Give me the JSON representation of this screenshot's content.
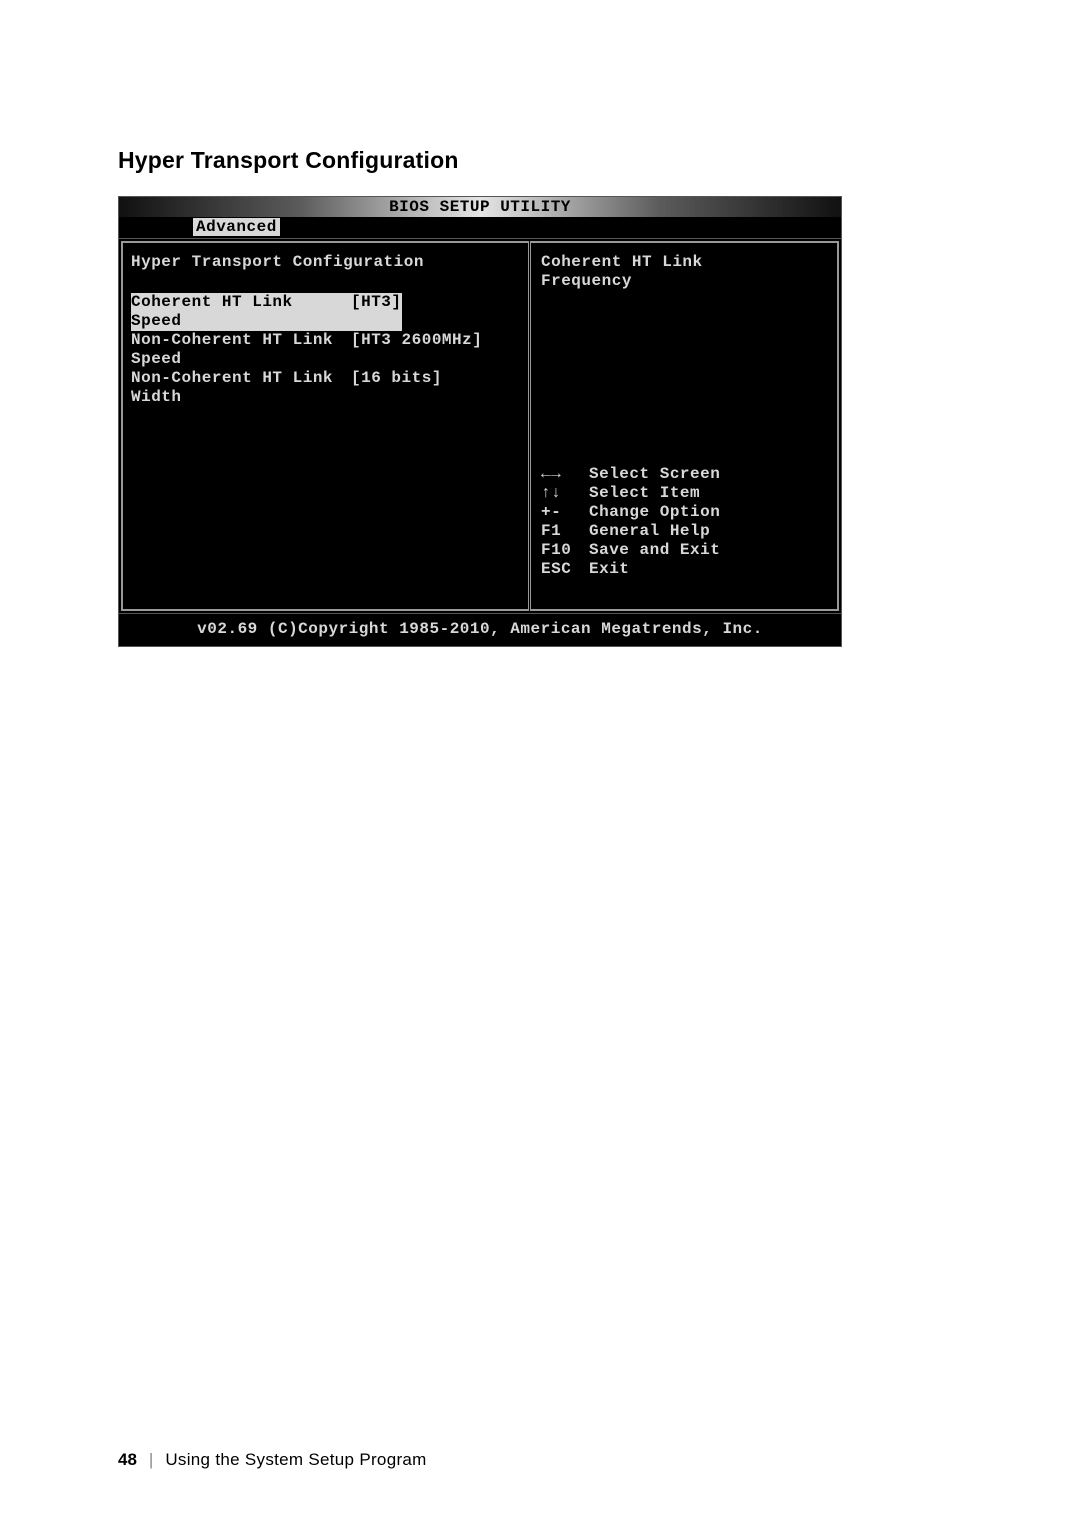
{
  "heading": "Hyper Transport Configuration",
  "bios": {
    "title": "BIOS SETUP UTILITY",
    "menu": {
      "active": "Advanced"
    },
    "left": {
      "title": "Hyper Transport Configuration",
      "settings": [
        {
          "label": "Coherent HT Link Speed",
          "value": "[HT3]",
          "selected": true
        },
        {
          "label": "Non-Coherent HT Link Speed",
          "value": "[HT3 2600MHz]",
          "selected": false
        },
        {
          "label": "Non-Coherent HT Link Width",
          "value": "[16 bits]",
          "selected": false
        }
      ]
    },
    "right": {
      "help_line1": "Coherent HT Link",
      "help_line2": "Frequency",
      "nav": [
        {
          "key": "←→",
          "desc": "Select Screen"
        },
        {
          "key": "↑↓",
          "desc": "Select Item"
        },
        {
          "key": "+-",
          "desc": "Change Option"
        },
        {
          "key": "F1",
          "desc": "General Help"
        },
        {
          "key": "F10",
          "desc": "Save and Exit"
        },
        {
          "key": "ESC",
          "desc": "Exit"
        }
      ]
    },
    "footer": "v02.69 (C)Copyright 1985-2010, American Megatrends, Inc."
  },
  "pagefoot": {
    "num": "48",
    "section": "Using the System Setup Program"
  }
}
